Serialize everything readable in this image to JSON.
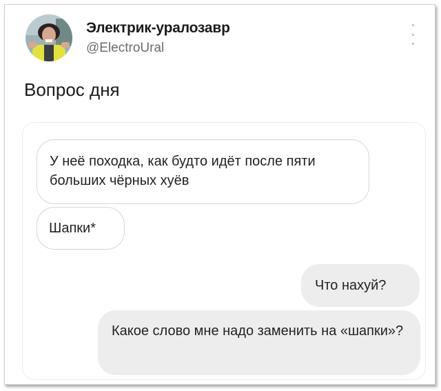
{
  "author": {
    "name": "Электрик-уралозавр",
    "handle": "@ElectroUral"
  },
  "tweet": {
    "text": "Вопрос дня"
  },
  "chat": {
    "messages": [
      {
        "side": "incoming",
        "text": "У неё походка, как будто идёт после пяти больших чёрных хуёв"
      },
      {
        "side": "incoming",
        "text": "Шапки*"
      },
      {
        "side": "outgoing",
        "text": "Что нахуй?"
      },
      {
        "side": "outgoing",
        "text": "Какое слово мне надо заменить на «шапки»?"
      }
    ]
  },
  "colors": {
    "outgoing_bubble": "#ededed",
    "incoming_border": "#d6d6d6",
    "handle_text": "#6b6b6b"
  },
  "icons": {
    "avatar": "person-photo",
    "menu": "more-vertical-icon"
  }
}
